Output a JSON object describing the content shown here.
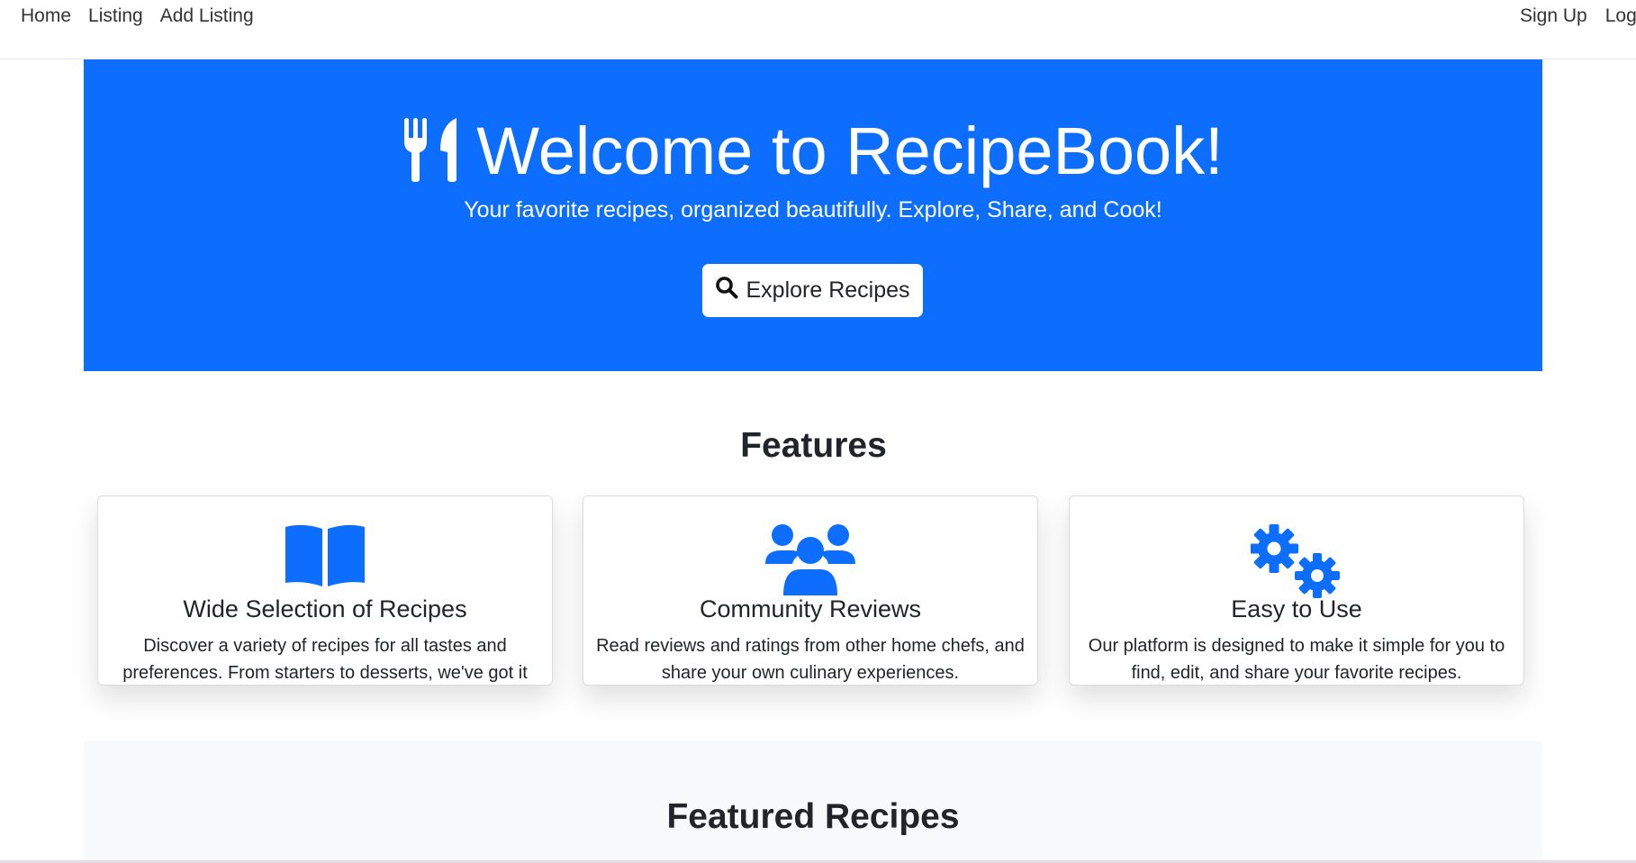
{
  "navbar": {
    "left_links": [
      "Home",
      "Listing",
      "Add Listing"
    ],
    "right_links": [
      "Sign Up",
      "Login"
    ]
  },
  "hero": {
    "icon": "utensils-icon",
    "title": "Welcome to RecipeBook!",
    "subtitle": "Your favorite recipes, organized beautifully. Explore, Share, and Cook!",
    "button_icon": "search-icon",
    "button_label": "Explore Recipes",
    "background_color": "#0d6efd"
  },
  "features": {
    "heading": "Features",
    "cards": [
      {
        "icon": "book-open-icon",
        "title": "Wide Selection of Recipes",
        "text": "Discover a variety of recipes for all tastes and preferences. From starters to desserts, we've got it all!"
      },
      {
        "icon": "users-icon",
        "title": "Community Reviews",
        "text": "Read reviews and ratings from other home chefs, and share your own culinary experiences."
      },
      {
        "icon": "cogs-icon",
        "title": "Easy to Use",
        "text": "Our platform is designed to make it simple for you to find, edit, and share your favorite recipes."
      }
    ],
    "icon_color": "#0d6efd"
  },
  "featured": {
    "heading": "Featured Recipes"
  }
}
